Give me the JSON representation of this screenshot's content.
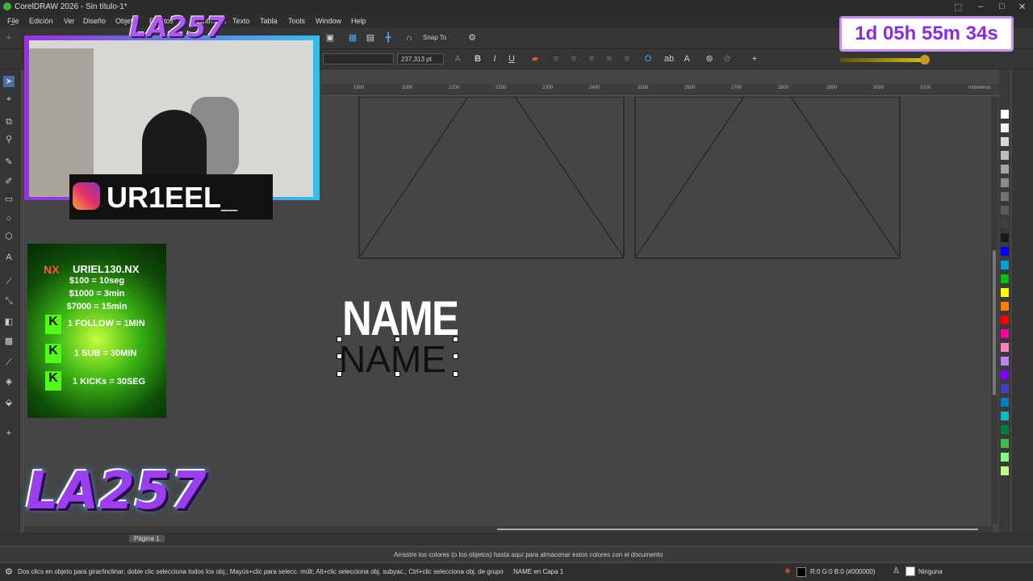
{
  "window": {
    "title": "CorelDRAW 2026 - Sin título-1*"
  },
  "menu": [
    "Fi̲le",
    "Edición",
    "Ver",
    "Diseño",
    "Objeto",
    "Efectos",
    "Bitmaps",
    "Texto",
    "Tabla",
    "Tools",
    "Window",
    "Help"
  ],
  "toolbar": {
    "snap_label": "Snap To",
    "font_size": "237,313 pt",
    "bold": "B",
    "italic": "I",
    "underline": "U"
  },
  "ruler": [
    "1900",
    "2000",
    "2100",
    "2200",
    "2300",
    "2400",
    "2500",
    "2600",
    "2700",
    "2800",
    "2900",
    "3000",
    "3100",
    "milímetros"
  ],
  "canvas": {
    "text_top": "NAME",
    "text_bottom": "NAME"
  },
  "overlays": {
    "instagram_handle": "UR1EEL_",
    "timer": "1d 05h 55m 34s",
    "donation": {
      "title": "URIEL130.NX",
      "lines": [
        "$100 = 10seg",
        "$1000 = 3min",
        "$7000 = 15min"
      ],
      "rows": [
        "1 FOLLOW = 1MIN",
        "1 SUB = 30MIN",
        "1 KICKs = 30SEG"
      ]
    },
    "logo_text": "LA257"
  },
  "page_tab": "Página 1",
  "color_hint": "Arrastre los colores (o los objetos) hasta aquí para almacenar estos colores con el documento",
  "status": {
    "hint": "Dos clics en objeto para girar/inclinar; doble clic selecciona todos los obj.; Mayús+clic para selecc. múlt; Alt+clic selecciona obj. subyac.; Ctrl+clic selecciona obj. de grupo",
    "object": "NAME en Capa 1",
    "fill": "R:0 G:0 B:0 (#000000)",
    "outline": "Ninguna"
  },
  "palette": [
    "#ffffff",
    "#f2f2f2",
    "#d9d9d9",
    "#bfbfbf",
    "#a6a6a6",
    "#8c8c8c",
    "#737373",
    "#595959",
    "#404040",
    "#1a1a1a",
    "#0000ff",
    "#00a0e0",
    "#00c000",
    "#ffff00",
    "#ff8000",
    "#ff0000",
    "#ff00a0",
    "#ff80c0",
    "#c080ff",
    "#8000ff",
    "#4040c0",
    "#0080c0",
    "#00c0c0",
    "#008040",
    "#40c040",
    "#80ff80",
    "#c0ff80"
  ]
}
